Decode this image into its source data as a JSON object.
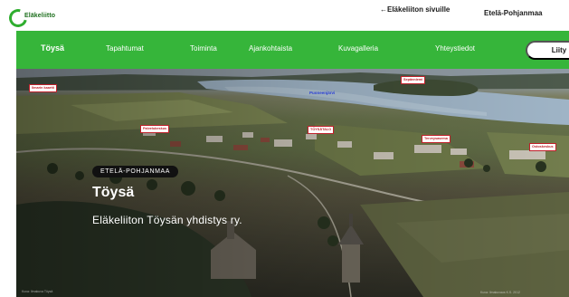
{
  "header": {
    "logo_text": "Eläkeliitto",
    "back_link": "←Eläkeliiton sivuille",
    "region_link": "Etelä-Pohjanmaa"
  },
  "nav": {
    "items": [
      {
        "label": "Töysä",
        "active": true
      },
      {
        "label": "Tapahtumat"
      },
      {
        "label": "Toiminta"
      },
      {
        "label": "Ajankohtaista"
      },
      {
        "label": "Kuvagalleria"
      },
      {
        "label": "Yhteystiedot"
      }
    ],
    "join_label": "Liity"
  },
  "hero": {
    "badge": "ETELÄ-POHJANMAA",
    "title": "Töysä",
    "subtitle": "Eläkeliiton Töysän yhdistys ry.",
    "map_labels": [
      "Ilmarin kaartti",
      "Sepänniemi",
      "Palvelukeskus",
      "TÖYSÄTALO",
      "Terveysasema",
      "Ostoskeskus"
    ],
    "lake_label": "Puoneenjärvi",
    "credit_left": "Kuva: Ilmakuva Töysä",
    "credit_right": "Kuva: Ilmakuvaus K.S. 2012"
  },
  "colors": {
    "brand_green": "#36b53a",
    "logo_green": "#2fae2f",
    "text_dark": "#1a1a1a",
    "map_label_red": "#c0202a"
  }
}
